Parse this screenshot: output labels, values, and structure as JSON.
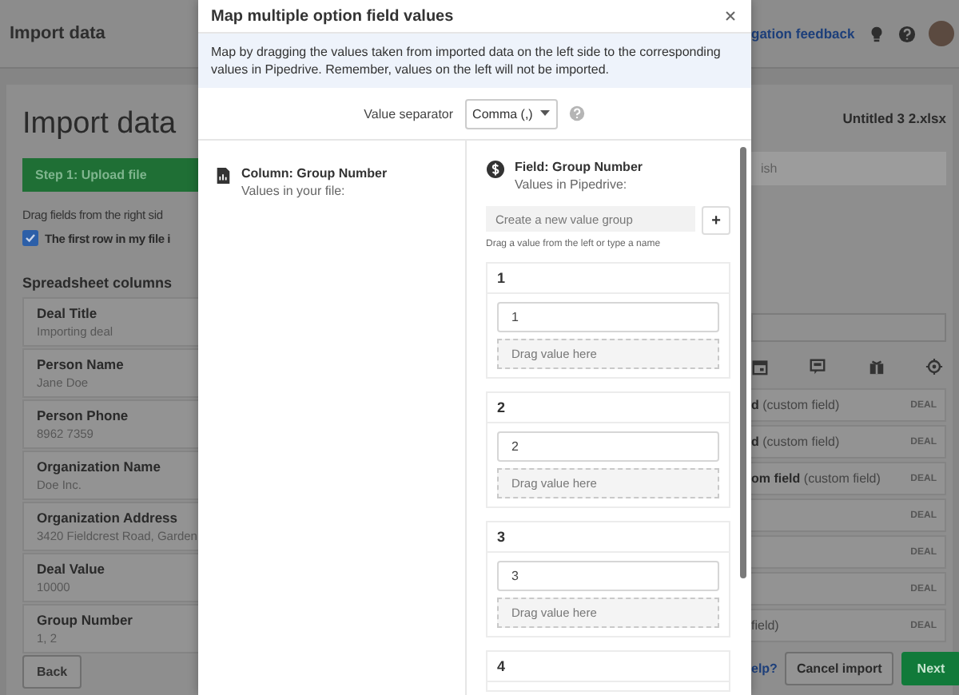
{
  "app_header": {
    "title": "Import data",
    "feedback_link": "gation feedback"
  },
  "page": {
    "title": "Import data",
    "filename": "Untitled 3 2.xlsx",
    "steps": [
      {
        "label": "Step 1: Upload file",
        "selected": true
      },
      {
        "label": "ish",
        "selected": false
      }
    ],
    "instruction": "Drag fields from the right sid",
    "first_row_checkbox": {
      "label": "The first row in my file i",
      "checked": true
    },
    "spreadsheet_columns": {
      "title": "Spreadsheet columns",
      "items": [
        {
          "name": "Deal Title",
          "value": "Importing deal"
        },
        {
          "name": "Person Name",
          "value": "Jane Doe"
        },
        {
          "name": "Person Phone",
          "value": "8962 7359"
        },
        {
          "name": "Organization Name",
          "value": "Doe Inc."
        },
        {
          "name": "Organization Address",
          "value": "3420 Fieldcrest Road, Garden"
        },
        {
          "name": "Deal Value",
          "value": "10000"
        },
        {
          "name": "Group Number",
          "value": "1, 2"
        }
      ]
    },
    "fields": [
      {
        "name": "d",
        "note": "(custom field)",
        "tag": "DEAL"
      },
      {
        "name": "d",
        "note": "(custom field)",
        "tag": "DEAL"
      },
      {
        "name": "om field",
        "note": "(custom field)",
        "tag": "DEAL"
      },
      {
        "tag": "DEAL"
      },
      {
        "tag": "DEAL"
      },
      {
        "tag": "DEAL"
      },
      {
        "note": "field)",
        "tag": "DEAL"
      }
    ],
    "footer": {
      "back": "Back",
      "help_link": "elp?",
      "cancel": "Cancel import",
      "next": "Next"
    }
  },
  "modal": {
    "title": "Map multiple option field values",
    "info": "Map by dragging the values taken from imported data on the left side to the corresponding values in Pipedrive. Remember, values on the left will not be imported.",
    "separator_label": "Value separator",
    "separator_value": "Comma (,)",
    "left": {
      "title": "Column: Group Number",
      "subtitle": "Values in your file:"
    },
    "right": {
      "title": "Field: Group Number",
      "subtitle": "Values in Pipedrive:",
      "new_group_placeholder": "Create a new value group",
      "add_button": "+",
      "hint": "Drag a value from the left or type a name",
      "groups": [
        {
          "label": "1",
          "values": [
            "1"
          ],
          "dropzone": "Drag value here"
        },
        {
          "label": "2",
          "values": [
            "2"
          ],
          "dropzone": "Drag value here"
        },
        {
          "label": "3",
          "values": [
            "3"
          ],
          "dropzone": "Drag value here"
        },
        {
          "label": "4"
        }
      ]
    }
  }
}
